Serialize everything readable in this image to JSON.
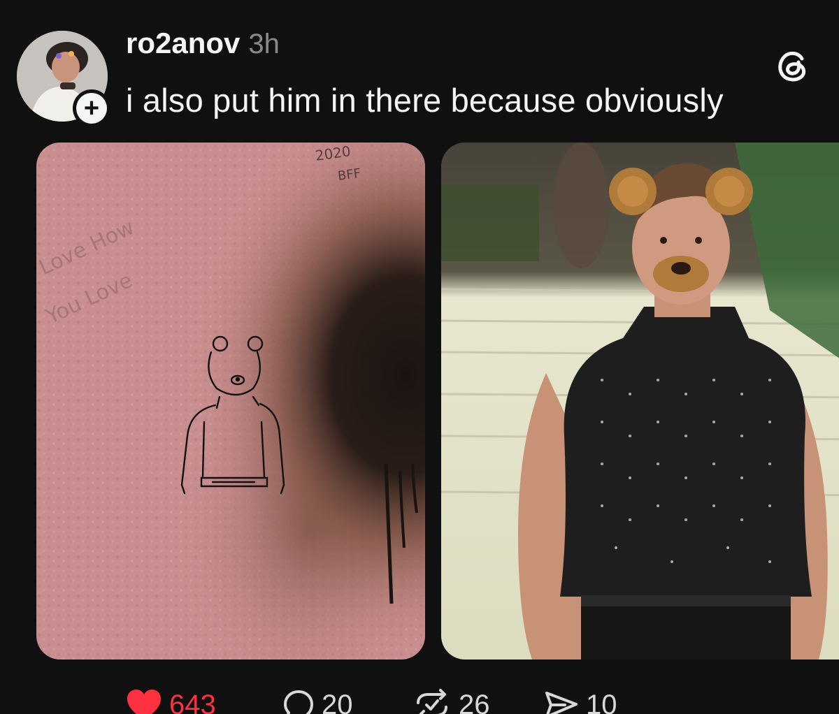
{
  "post": {
    "username": "ro2anov",
    "timestamp": "3h",
    "caption": "i also put him in there because obviously"
  },
  "media": {
    "left_image": {
      "wall_text": [
        "2020",
        "BFF"
      ],
      "colors": {
        "wall": "#c98e8f",
        "soot": "#2a1d18"
      }
    },
    "right_image": {
      "colors": {
        "top": "#1f1f1f",
        "skin": "#c99579",
        "ears": "#b07a3a"
      }
    }
  },
  "actions": {
    "likes": "643",
    "replies": "20",
    "reposts": "26",
    "shares": "10"
  },
  "icons": {
    "threads": "threads-logo-icon",
    "follow": "plus-icon",
    "like": "heart-icon",
    "reply": "comment-bubble-icon",
    "repost": "repost-arrows-icon",
    "share": "paper-plane-icon"
  },
  "colors": {
    "background": "#101010",
    "text": "#f3f5f7",
    "muted": "#8a8a8a",
    "like": "#ff3040"
  }
}
